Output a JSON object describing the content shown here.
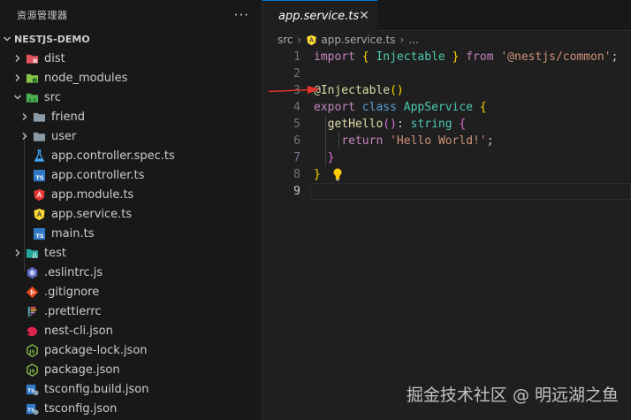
{
  "sidebar": {
    "title": "资源管理器",
    "more": "···",
    "root": "NESTJS-DEMO",
    "items": [
      {
        "label": "dist",
        "icon": "dist-folder-icon",
        "kind": "folder"
      },
      {
        "label": "node_modules",
        "icon": "node-modules-folder-icon",
        "kind": "folder"
      },
      {
        "label": "src",
        "icon": "src-folder-icon",
        "kind": "folder-open"
      },
      {
        "label": "friend",
        "icon": "folder-icon",
        "kind": "folder"
      },
      {
        "label": "user",
        "icon": "folder-icon",
        "kind": "folder"
      },
      {
        "label": "app.controller.spec.ts",
        "icon": "test-flask-icon",
        "kind": "file"
      },
      {
        "label": "app.controller.ts",
        "icon": "typescript-icon",
        "kind": "file"
      },
      {
        "label": "app.module.ts",
        "icon": "angular-module-icon",
        "kind": "file"
      },
      {
        "label": "app.service.ts",
        "icon": "angular-service-icon",
        "kind": "file"
      },
      {
        "label": "main.ts",
        "icon": "typescript-icon",
        "kind": "file"
      },
      {
        "label": "test",
        "icon": "test-folder-icon",
        "kind": "folder"
      },
      {
        "label": ".eslintrc.js",
        "icon": "eslint-icon",
        "kind": "file"
      },
      {
        "label": ".gitignore",
        "icon": "git-icon",
        "kind": "file"
      },
      {
        "label": ".prettierrc",
        "icon": "prettier-icon",
        "kind": "file"
      },
      {
        "label": "nest-cli.json",
        "icon": "nest-icon",
        "kind": "file"
      },
      {
        "label": "package-lock.json",
        "icon": "json-js-icon",
        "kind": "file"
      },
      {
        "label": "package.json",
        "icon": "json-js-icon",
        "kind": "file"
      },
      {
        "label": "tsconfig.build.json",
        "icon": "tsconfig-icon",
        "kind": "file"
      },
      {
        "label": "tsconfig.json",
        "icon": "tsconfig-icon",
        "kind": "file"
      }
    ]
  },
  "editor": {
    "tab": {
      "label": "app.service.ts",
      "close": "✕"
    },
    "breadcrumb": {
      "folder": "src",
      "file": "app.service.ts",
      "tail": "..."
    },
    "line_numbers": [
      "1",
      "2",
      "3",
      "4",
      "5",
      "6",
      "7",
      "8",
      "9"
    ],
    "code": {
      "l1_import": "import",
      "l1_brace_open": "{",
      "l1_ident": "Injectable",
      "l1_brace_close": "}",
      "l1_from": "from",
      "l1_module": "'@nestjs/common'",
      "l1_semi": ";",
      "l3_decorator": "@Injectable",
      "l3_parens": "()",
      "l4_export": "export",
      "l4_class": "class",
      "l4_name": "AppService",
      "l4_brace": "{",
      "l5_fn": "getHello",
      "l5_parens": "()",
      "l5_colon": ":",
      "l5_type": "string",
      "l5_brace": "{",
      "l6_return": "return",
      "l6_string": "'Hello World!'",
      "l6_semi": ";",
      "l7_brace": "}",
      "l8_brace": "}"
    }
  },
  "watermark": "掘金技术社区 @ 明远湖之鱼",
  "colors": {
    "accent": "#0078d4",
    "keyword": "#569cd6",
    "control": "#c586c0",
    "type": "#4ec9b0",
    "function": "#dcdcaa",
    "string": "#ce9178",
    "arrow": "#e0342c"
  }
}
